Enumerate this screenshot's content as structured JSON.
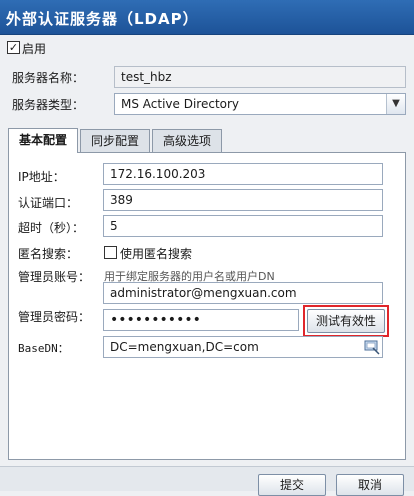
{
  "window": {
    "title": "外部认证服务器（LDAP）"
  },
  "enable": {
    "label": "启用",
    "checked": true
  },
  "server": {
    "name_label": "服务器名称：",
    "name_value": "test_hbz",
    "type_label": "服务器类型：",
    "type_value": "MS Active Directory"
  },
  "tabs": [
    {
      "label": "基本配置",
      "active": true
    },
    {
      "label": "同步配置",
      "active": false
    },
    {
      "label": "高级选项",
      "active": false
    }
  ],
  "form": {
    "ip_label": "IP地址：",
    "ip_value": "172.16.100.203",
    "port_label": "认证端口：",
    "port_value": "389",
    "timeout_label": "超时（秒）：",
    "timeout_value": "5",
    "anon_label": "匿名搜索：",
    "anon_checkbox_label": "使用匿名搜索",
    "anon_checked": false,
    "admin_label": "管理员账号：",
    "admin_hint": "用于绑定服务器的用户名或用户DN",
    "admin_value": "administrator@mengxuan.com",
    "password_label": "管理员密码：",
    "password_mask": "•••••••••••",
    "test_button": "测试有效性",
    "basedn_label": "BaseDN：",
    "basedn_value": "DC=mengxuan,DC=com"
  },
  "footer": {
    "submit": "提交",
    "cancel": "取消"
  },
  "colors": {
    "titlebar": "#1d5398",
    "highlight": "#e0262b"
  }
}
